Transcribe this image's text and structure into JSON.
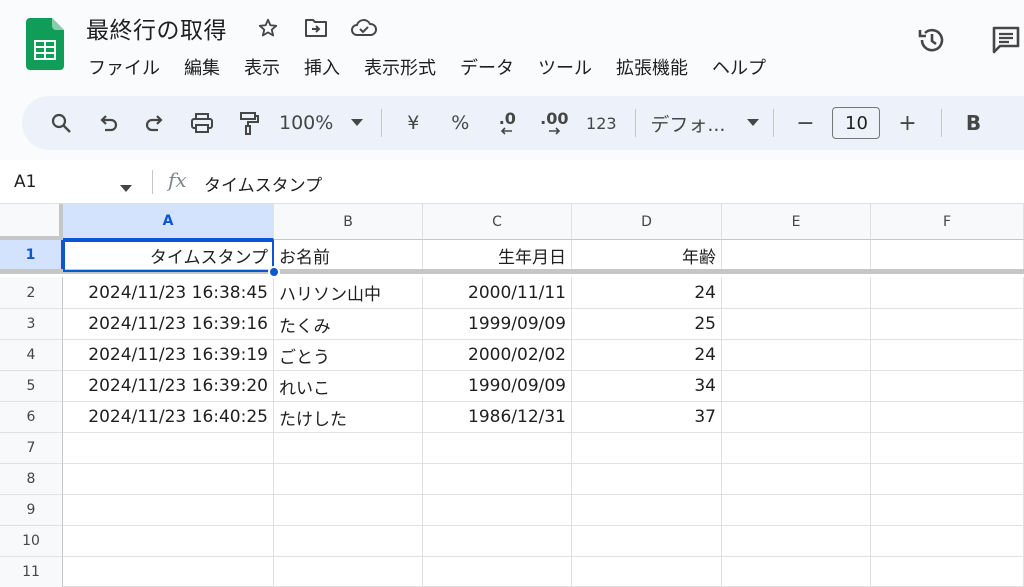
{
  "app": {
    "doc_title": "最終行の取得",
    "menu": [
      "ファイル",
      "編集",
      "表示",
      "挿入",
      "表示形式",
      "データ",
      "ツール",
      "拡張機能",
      "ヘルプ"
    ]
  },
  "toolbar": {
    "zoom": "100%",
    "currency": "¥",
    "percent": "%",
    "dec_decrease": ".0",
    "dec_increase": ".00",
    "number_format": "123",
    "font": "デフォ...",
    "minus": "−",
    "font_size": "10",
    "plus": "+",
    "bold": "B"
  },
  "formula_bar": {
    "cell_ref": "A1",
    "fx": "fx",
    "value": "タイムスタンプ"
  },
  "grid": {
    "columns": [
      "A",
      "B",
      "C",
      "D",
      "E",
      "F"
    ],
    "rows": [
      "1",
      "2",
      "3",
      "4",
      "5",
      "6",
      "7",
      "8",
      "9",
      "10",
      "11"
    ],
    "data": [
      [
        "タイムスタンプ",
        "お名前",
        "生年月日",
        "年齢"
      ],
      [
        "2024/11/23 16:38:45",
        "ハリソン山中",
        "2000/11/11",
        "24"
      ],
      [
        "2024/11/23 16:39:16",
        "たくみ",
        "1999/09/09",
        "25"
      ],
      [
        "2024/11/23 16:39:19",
        "ごとう",
        "2000/02/02",
        "24"
      ],
      [
        "2024/11/23 16:39:20",
        "れいこ",
        "1990/09/09",
        "34"
      ],
      [
        "2024/11/23 16:40:25",
        "たけした",
        "1986/12/31",
        "37"
      ]
    ],
    "selected_cell": "A1"
  },
  "colors": {
    "accent": "#0b57d0",
    "selection_bg": "#d3e3fd",
    "sheets_green": "#0f9d58"
  }
}
